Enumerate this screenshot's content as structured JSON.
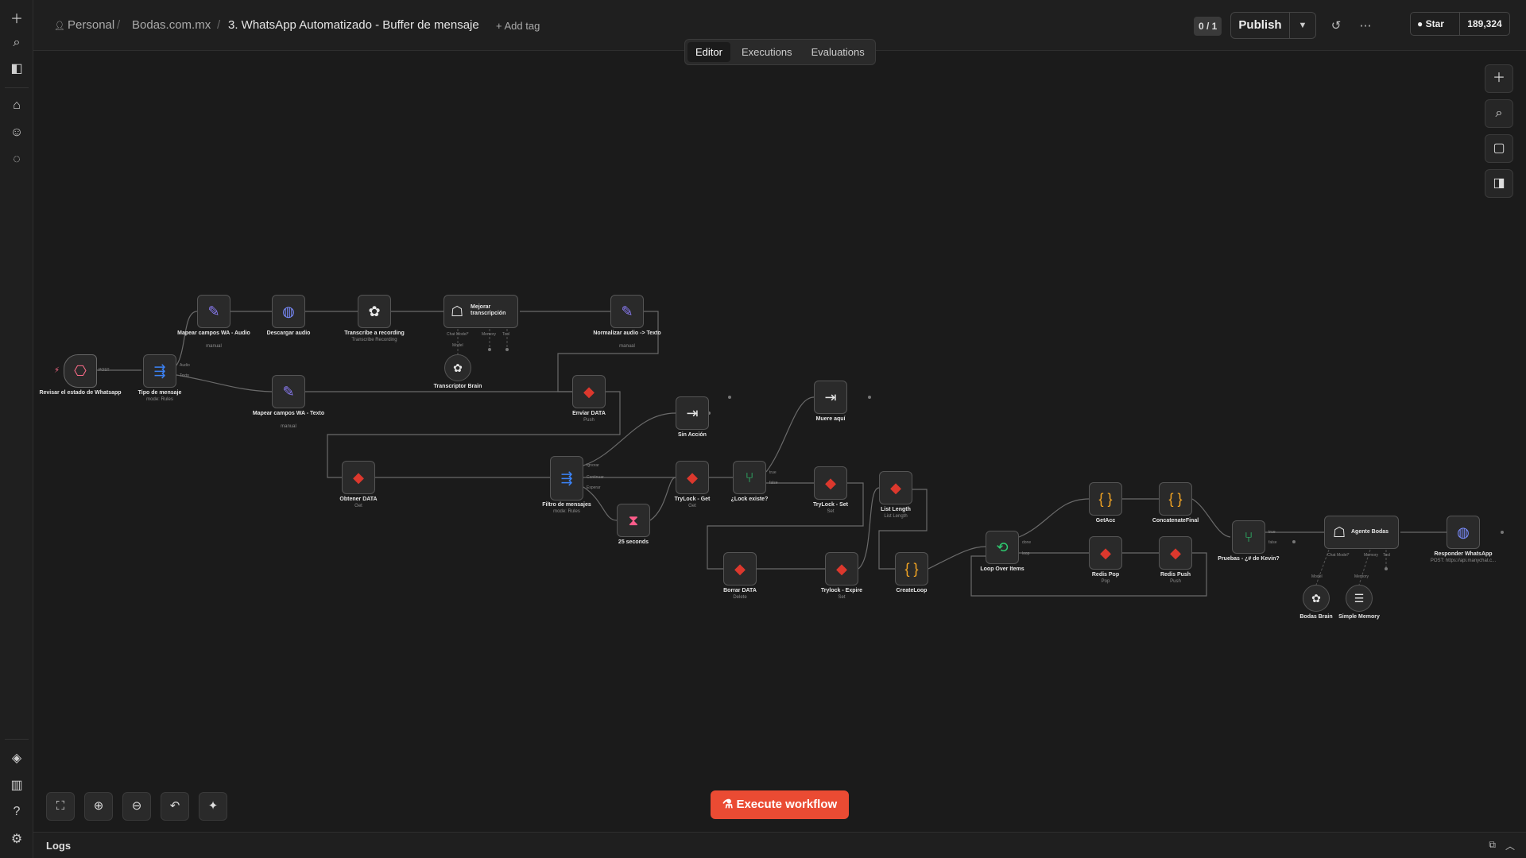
{
  "sidebar": {
    "top_icons": [
      "plus-icon",
      "search-icon",
      "panel-toggle-icon",
      "home-icon",
      "user-icon",
      "chat-icon"
    ],
    "bottom_icons": [
      "templates-icon",
      "insights-icon",
      "help-icon",
      "settings-icon"
    ]
  },
  "header": {
    "breadcrumb_project": "Personal",
    "breadcrumb_folder": "Bodas.com.mx",
    "workflow_title": "3. WhatsApp Automatizado - Buffer de mensaje",
    "add_tag": "+ Add tag",
    "version_counter": "0 / 1",
    "publish_label": "Publish",
    "github_star_label": "Star",
    "github_star_count": "189,324"
  },
  "tabs": [
    {
      "label": "Editor",
      "active": true
    },
    {
      "label": "Executions",
      "active": false
    },
    {
      "label": "Evaluations",
      "active": false
    }
  ],
  "canvas": {
    "nodes": {
      "revisar": {
        "label": "Revisar el estado de Whatsapp",
        "icon": "webhook-icon"
      },
      "tipo": {
        "label": "Tipo de mensaje",
        "subtitle": "mode: Rules",
        "icon": "switch-icon"
      },
      "mapear_audio": {
        "label": "Mapear campos WA - Audio",
        "subtitle": "manual",
        "icon": "edit-icon"
      },
      "descargar": {
        "label": "Descargar audio",
        "icon": "globe-icon"
      },
      "transcribe": {
        "label": "Transcribe a recording",
        "subtitle": "Transcribe Recording",
        "icon": "openai-icon"
      },
      "mejorar": {
        "label": "Mejorar transcripción",
        "icon": "robot-icon"
      },
      "normalizar": {
        "label": "Normalizar audio -> Texto",
        "subtitle": "manual",
        "icon": "edit-icon"
      },
      "transcriptor": {
        "label": "Transcriptor Brain",
        "icon": "openai-icon"
      },
      "mapear_texto": {
        "label": "Mapear campos WA - Texto",
        "subtitle": "manual",
        "icon": "edit-icon"
      },
      "enviar": {
        "label": "Enviar DATA",
        "subtitle": "Push",
        "icon": "redis-icon"
      },
      "obtener": {
        "label": "Obtener DATA",
        "subtitle": "Get",
        "icon": "redis-icon"
      },
      "filtro": {
        "label": "Filtro de mensajes",
        "subtitle": "mode: Rules",
        "icon": "switch-icon"
      },
      "sin_accion": {
        "label": "Sin Acción",
        "icon": "noop-icon"
      },
      "seconds": {
        "label": "25 seconds",
        "icon": "hourglass-icon"
      },
      "trylock_get": {
        "label": "TryLock - Get",
        "subtitle": "Get",
        "icon": "redis-icon"
      },
      "lock_existe": {
        "label": "¿Lock existe?",
        "icon": "if-icon"
      },
      "muere": {
        "label": "Muere aquí",
        "icon": "noop-icon"
      },
      "trylock_set": {
        "label": "TryLock - Set",
        "subtitle": "Set",
        "icon": "redis-icon"
      },
      "list_length": {
        "label": "List Length",
        "subtitle": "List Length",
        "icon": "redis-icon"
      },
      "borrar": {
        "label": "Borrar DATA",
        "subtitle": "Delete",
        "icon": "redis-icon"
      },
      "trylock_expire": {
        "label": "Trylock - Expire",
        "subtitle": "Set",
        "icon": "redis-icon"
      },
      "createloop": {
        "label": "CreateLoop",
        "icon": "code-icon"
      },
      "loop": {
        "label": "Loop Over Items",
        "icon": "loop-icon"
      },
      "getacc": {
        "label": "GetAcc",
        "icon": "code-icon"
      },
      "concatenate": {
        "label": "ConcatenateFinal",
        "icon": "code-icon"
      },
      "redis_pop": {
        "label": "Redis Pop",
        "subtitle": "Pop",
        "icon": "redis-icon"
      },
      "redis_push": {
        "label": "Redis Push",
        "subtitle": "Push",
        "icon": "redis-icon"
      },
      "pruebas": {
        "label": "Pruebas - ¿# de Kevin?",
        "icon": "if-icon"
      },
      "agente": {
        "label": "Agente Bodas",
        "icon": "robot-icon"
      },
      "responder": {
        "label": "Responder WhatsApp",
        "subtitle": "POST: https://api.manychat.c...",
        "icon": "globe-icon"
      },
      "bodas_brain": {
        "label": "Bodas Brain",
        "icon": "openai-icon"
      },
      "simple_memory": {
        "label": "Simple Memory",
        "icon": "database-icon"
      }
    },
    "ports": {
      "post": "POST",
      "audio": "Audio",
      "texto": "Texto",
      "chat_model": "Chat Model*",
      "memory": "Memory",
      "tool": "Tool",
      "model": "Model",
      "ignorar": "Ignorar",
      "continuar": "Continuar",
      "esperar": "Esperar",
      "true": "true",
      "false": "false",
      "done": "done",
      "loop": "loop"
    }
  },
  "right_tools": [
    "plus-icon",
    "search-icon",
    "sticky-note-icon",
    "panel-icon"
  ],
  "bottom_tools": [
    "fit-view-icon",
    "zoom-in-icon",
    "zoom-out-icon",
    "undo-icon",
    "tidy-icon"
  ],
  "execute_button": "Execute workflow",
  "logs": {
    "label": "Logs"
  },
  "colors": {
    "accent": "#ea4b33",
    "canvas_bg": "#1b1b1b",
    "redis": "#dc382d",
    "switch": "#3b82f6",
    "if_node": "#2ecc71",
    "edit": "#8b7cf6",
    "code": "#f5a623",
    "webhook": "#ff6d8a"
  }
}
